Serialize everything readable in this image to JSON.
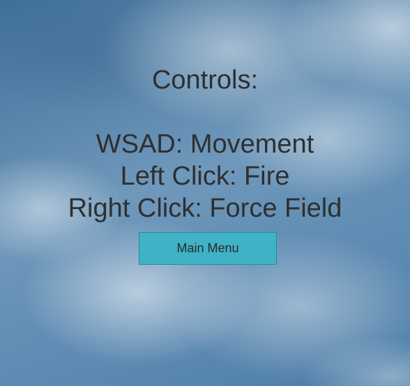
{
  "background": {
    "description_color": "#5b89b0"
  },
  "controls": {
    "title": "Controls:",
    "lines": [
      "WSAD: Movement",
      "Left Click: Fire",
      "Right Click: Force Field"
    ],
    "text_color": "#2f2f2f"
  },
  "menu": {
    "main_menu_label": "Main Menu",
    "button_color": "#3fb2c6"
  }
}
